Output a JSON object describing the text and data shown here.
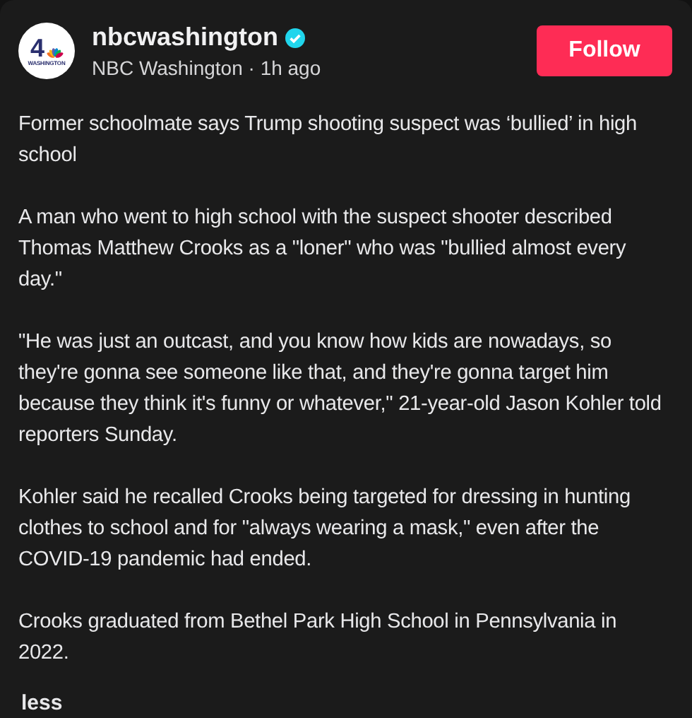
{
  "author": {
    "logo": {
      "number": "4",
      "caption": "WASHINGTON"
    },
    "username": "nbcwashington",
    "verified": true,
    "display_name": "NBC Washington",
    "separator": "·",
    "time": "1h ago"
  },
  "follow_button": "Follow",
  "paragraphs": [
    "Former schoolmate says Trump shooting suspect was ‘bullied’ in high school",
    "A man who went to high school with the suspect shooter described Thomas Matthew Crooks as a \"loner\" who was \"bullied almost every day.\"",
    "\"He was just an outcast, and you know how kids are nowadays, so they're gonna see someone like that, and they're gonna target him because they think it's funny or whatever,\" 21-year-old Jason Kohler told reporters Sunday.",
    "Kohler said he recalled Crooks being targeted for dressing in hunting clothes to school and for \"always wearing a mask,\" even after the COVID-19 pandemic had ended.",
    "Crooks graduated from Bethel Park High School in Pennsylvania in 2022."
  ],
  "less_link": "less"
}
